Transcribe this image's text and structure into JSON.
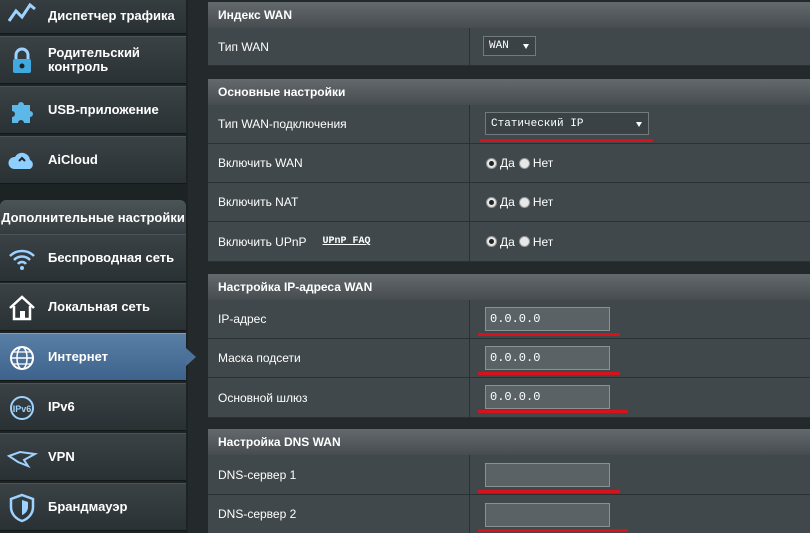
{
  "sidebar": {
    "items": [
      {
        "label": "Диспетчер трафика",
        "icon": "traffic-manager-icon"
      },
      {
        "label": "Родительский контроль",
        "icon": "lock-icon"
      },
      {
        "label": "USB-приложение",
        "icon": "puzzle-icon"
      },
      {
        "label": "AiCloud",
        "icon": "cloud-icon"
      },
      {
        "label": "Беспроводная сеть",
        "icon": "wifi-icon"
      },
      {
        "label": "Локальная сеть",
        "icon": "home-icon"
      },
      {
        "label": "Интернет",
        "icon": "globe-icon"
      },
      {
        "label": "IPv6",
        "icon": "ipv6-icon"
      },
      {
        "label": "VPN",
        "icon": "vpn-icon"
      },
      {
        "label": "Брандмауэр",
        "icon": "shield-icon"
      }
    ],
    "advanced_header": "Дополнительные настройки"
  },
  "sections": {
    "wan_index": {
      "title": "Индекс WAN",
      "wan_type_label": "Тип WAN",
      "wan_type_value": "WAN"
    },
    "basic": {
      "title": "Основные настройки",
      "conn_type_label": "Тип WAN-подключения",
      "conn_type_value": "Статический IP",
      "enable_wan_label": "Включить WAN",
      "enable_nat_label": "Включить NAT",
      "enable_upnp_label": "Включить UPnP",
      "upnp_faq": "UPnP FAQ",
      "yes": "Да",
      "no": "Нет"
    },
    "ip": {
      "title": "Настройка IP-адреса WAN",
      "ip_label": "IP-адрес",
      "ip_value": "0.0.0.0",
      "mask_label": "Маска подсети",
      "mask_value": "0.0.0.0",
      "gateway_label": "Основной шлюз",
      "gateway_value": "0.0.0.0"
    },
    "dns": {
      "title": "Настройка DNS WAN",
      "dns1_label": "DNS-сервер 1",
      "dns1_value": "",
      "dns2_label": "DNS-сервер 2",
      "dns2_value": ""
    }
  },
  "colors": {
    "accent_active": "#4d7299",
    "highlight_underline": "#d9111a"
  }
}
